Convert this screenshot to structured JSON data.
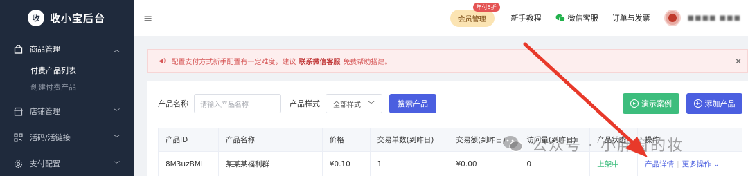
{
  "sidebar": {
    "logo_badge": "收",
    "logo_text": "收小宝后台",
    "groups": [
      {
        "label": "商品管理",
        "icon": "shopping-bag-icon",
        "expanded": true
      },
      {
        "label": "店铺管理",
        "icon": "store-icon",
        "expanded": false
      },
      {
        "label": "活码/活链接",
        "icon": "qr-code-icon",
        "expanded": false
      },
      {
        "label": "支付配置",
        "icon": "gear-icon",
        "expanded": false
      }
    ],
    "subitems": [
      {
        "label": "付费产品列表",
        "active": true
      },
      {
        "label": "创建付费产品",
        "active": false
      }
    ]
  },
  "header": {
    "vip_label": "会员管理",
    "vip_badge": "年付5折",
    "tutorial": "新手教程",
    "support": "微信客服",
    "orders": "订单与发票",
    "username": "■■■■ ■■■"
  },
  "notice": {
    "text_before": "配置支付方式新手配置有一定难度，建议",
    "link": "联系微信客服",
    "text_after": "免费帮助搭建。"
  },
  "filters": {
    "name_label": "产品名称",
    "name_placeholder": "请输入产品名称",
    "style_label": "产品样式",
    "style_value": "全部样式",
    "search_button": "搜索产品",
    "demo_button": "演示案例",
    "add_button": "添加产品"
  },
  "table": {
    "headers": [
      "产品ID",
      "产品名称",
      "价格",
      "交易单数(到昨日)",
      "交易额(到昨日)",
      "访问量(到昨日)",
      "产品状态",
      "操作"
    ],
    "rows": [
      {
        "id": "8M3uzBML",
        "name": "某某某福利群",
        "price": "¥0.10",
        "orders": "1",
        "amount": "¥0.00",
        "visits": "0",
        "status": "上架中",
        "detail": "产品详情",
        "more": "更多操作"
      }
    ]
  },
  "watermark": {
    "text": "公众号 · 小胖窗的妆"
  },
  "colors": {
    "sidebar_bg": "#1f2a3c",
    "primary": "#4b5fe0",
    "success": "#3dbd7d",
    "danger": "#d65656",
    "arrow": "#e8392a"
  }
}
